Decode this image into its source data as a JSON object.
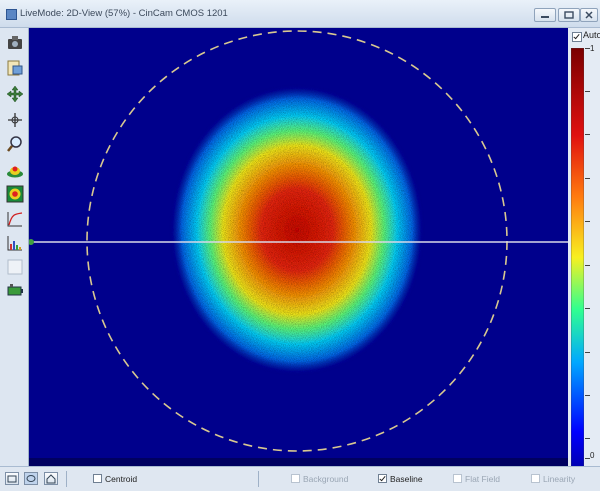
{
  "window": {
    "title": "LiveMode: 2D-View (57%) - CinCam CMOS 1201"
  },
  "colorbar": {
    "auto_label": "Auto",
    "auto_checked": true,
    "max_label": "1",
    "min_label": "0"
  },
  "status_bar": {
    "centroid": {
      "label": "Centroid",
      "checked": false,
      "enabled": true
    },
    "background": {
      "label": "Background",
      "checked": false,
      "enabled": false
    },
    "baseline": {
      "label": "Baseline",
      "checked": true,
      "enabled": true
    },
    "flat_field": {
      "label": "Flat Field",
      "checked": false,
      "enabled": false
    },
    "linearity": {
      "label": "Linearity",
      "checked": false,
      "enabled": false
    }
  },
  "toolbar_icons": [
    "camera-icon",
    "export-icon",
    "pan-icon",
    "crosshair-icon",
    "zoom-icon",
    "3d-view-icon",
    "2d-view-icon",
    "profile-icon",
    "histogram-icon",
    "blank-icon",
    "battery-icon"
  ],
  "colors": {
    "background_field": "#00008c",
    "profile_line": "#d8d8e8",
    "aperture_circle": "#d8c890"
  }
}
